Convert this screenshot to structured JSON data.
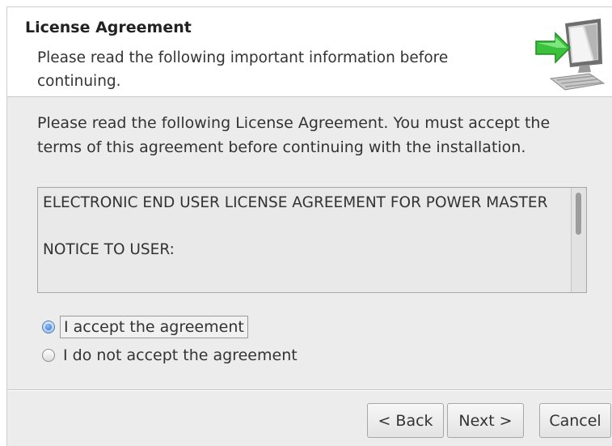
{
  "header": {
    "title": "License Agreement",
    "subtitle": "Please read the following important information before continuing.",
    "icon": "computer-install-icon"
  },
  "body": {
    "instructions": "Please read the following License Agreement. You must accept the terms of this agreement before continuing with the installation."
  },
  "license": {
    "text": "ELECTRONIC END USER LICENSE AGREEMENT FOR POWER MASTER\n\nNOTICE TO USER:"
  },
  "options": [
    {
      "label": "I accept the agreement",
      "selected": true
    },
    {
      "label": "I do not accept the agreement",
      "selected": false
    }
  ],
  "buttons": {
    "back": "< Back",
    "next": "Next >",
    "cancel": "Cancel"
  },
  "colors": {
    "accent_arrow": "#3cc13c",
    "radio_selected": "#2f6fc4"
  }
}
